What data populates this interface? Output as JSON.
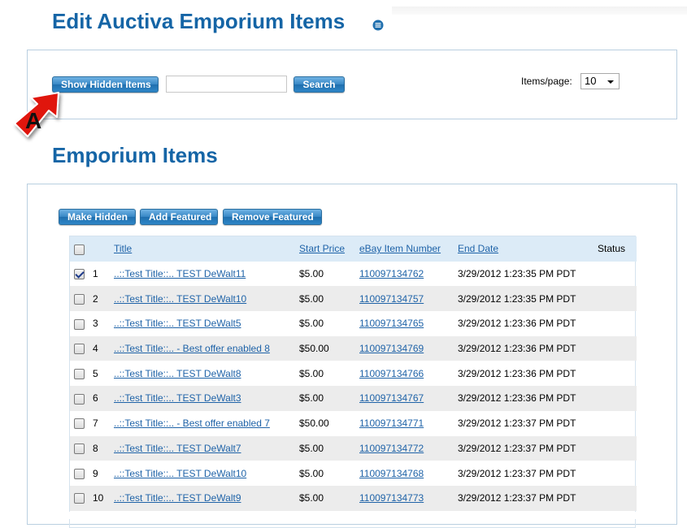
{
  "header": {
    "title": "Edit Auctiva Emporium Items"
  },
  "search": {
    "show_hidden_label": "Show Hidden Items",
    "input_value": "",
    "search_label": "Search",
    "items_per_page_label": "Items/page:",
    "items_per_page_value": "10"
  },
  "callout": {
    "letter": "A",
    "color": "#e0120f"
  },
  "items": {
    "title": "Emporium Items",
    "actions": {
      "make_hidden": "Make Hidden",
      "add_featured": "Add Featured",
      "remove_featured": "Remove Featured"
    },
    "columns": {
      "title": "Title",
      "start_price": "Start Price",
      "ebay_item_number": "eBay Item Number",
      "end_date": "End Date",
      "status": "Status"
    },
    "rows": [
      {
        "num": "1",
        "checked": true,
        "title": "..::Test Title::.. TEST DeWalt11",
        "price": "$5.00",
        "ebay": "110097134762",
        "end": "3/29/2012 1:23:35 PM PDT"
      },
      {
        "num": "2",
        "checked": false,
        "title": "..::Test Title::.. TEST DeWalt10",
        "price": "$5.00",
        "ebay": "110097134757",
        "end": "3/29/2012 1:23:35 PM PDT"
      },
      {
        "num": "3",
        "checked": false,
        "title": "..::Test Title::.. TEST DeWalt5",
        "price": "$5.00",
        "ebay": "110097134765",
        "end": "3/29/2012 1:23:36 PM PDT"
      },
      {
        "num": "4",
        "checked": false,
        "title": "..::Test Title::.. - Best offer enabled 8",
        "price": "$50.00",
        "ebay": "110097134769",
        "end": "3/29/2012 1:23:36 PM PDT"
      },
      {
        "num": "5",
        "checked": false,
        "title": "..::Test Title::.. TEST DeWalt8",
        "price": "$5.00",
        "ebay": "110097134766",
        "end": "3/29/2012 1:23:36 PM PDT"
      },
      {
        "num": "6",
        "checked": false,
        "title": "..::Test Title::.. TEST DeWalt3",
        "price": "$5.00",
        "ebay": "110097134767",
        "end": "3/29/2012 1:23:36 PM PDT"
      },
      {
        "num": "7",
        "checked": false,
        "title": "..::Test Title::.. - Best offer enabled 7",
        "price": "$50.00",
        "ebay": "110097134771",
        "end": "3/29/2012 1:23:37 PM PDT"
      },
      {
        "num": "8",
        "checked": false,
        "title": "..::Test Title::.. TEST DeWalt7",
        "price": "$5.00",
        "ebay": "110097134772",
        "end": "3/29/2012 1:23:37 PM PDT"
      },
      {
        "num": "9",
        "checked": false,
        "title": "..::Test Title::.. TEST DeWalt10",
        "price": "$5.00",
        "ebay": "110097134768",
        "end": "3/29/2012 1:23:37 PM PDT"
      },
      {
        "num": "10",
        "checked": false,
        "title": "..::Test Title::.. TEST DeWalt9",
        "price": "$5.00",
        "ebay": "110097134773",
        "end": "3/29/2012 1:23:37 PM PDT"
      }
    ]
  }
}
